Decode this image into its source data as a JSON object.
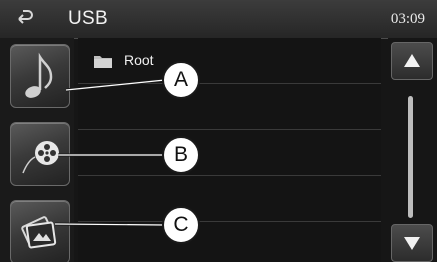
{
  "header": {
    "title": "USB",
    "clock": "03:09",
    "back_icon": "back-arrow-icon"
  },
  "sidebar": {
    "buttons": [
      {
        "name": "music",
        "icon": "music-note-icon",
        "callout": "A"
      },
      {
        "name": "video",
        "icon": "film-reel-icon",
        "callout": "B"
      },
      {
        "name": "photo",
        "icon": "photo-icon",
        "callout": "C"
      }
    ]
  },
  "list": {
    "items": [
      {
        "icon": "folder-icon",
        "label": "Root"
      }
    ]
  },
  "scroll": {
    "up_icon": "triangle-up-icon",
    "down_icon": "triangle-down-icon"
  },
  "colors": {
    "background": "#161616",
    "header": "#2e2e2e",
    "text": "#f0f0f0",
    "callout_fill": "#ffffff"
  }
}
